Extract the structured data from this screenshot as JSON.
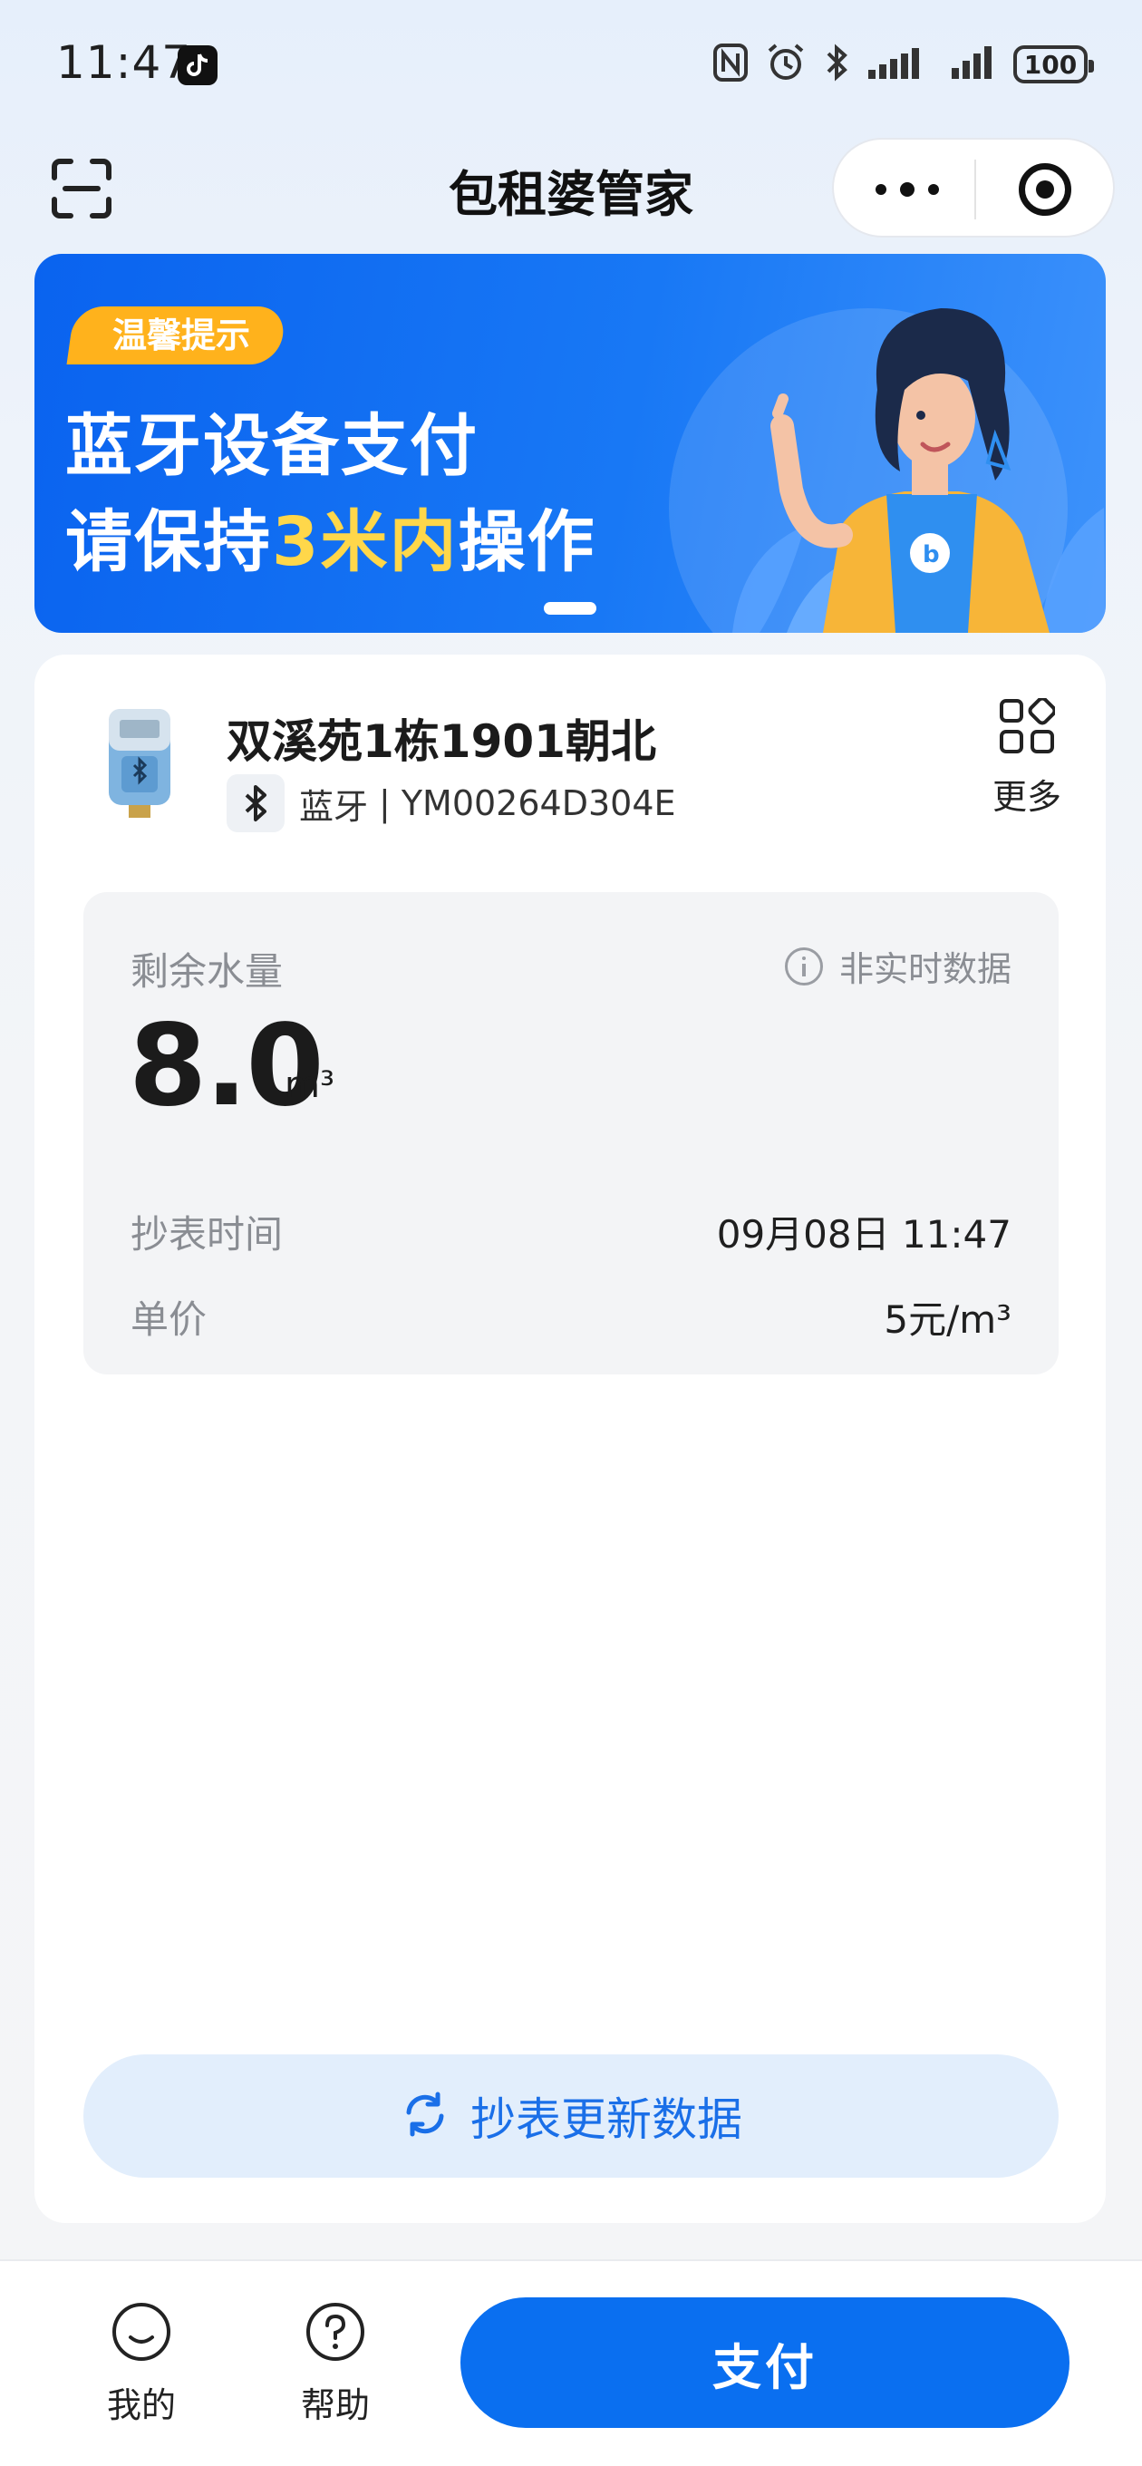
{
  "status_bar": {
    "time": "11:47",
    "battery": "100",
    "icons": [
      "tiktok-icon",
      "nfc-icon",
      "alarm-icon",
      "bluetooth-icon",
      "signal-icon",
      "signal-icon",
      "battery-icon"
    ]
  },
  "navbar": {
    "title": "包租婆管家",
    "icons": [
      "scan-icon",
      "more-dots-icon",
      "close-target-icon"
    ]
  },
  "banner": {
    "tag": "温馨提示",
    "line1": "蓝牙设备支付",
    "line2_prefix": "请保持",
    "line2_highlight": "3米内",
    "line2_suffix": "操作",
    "highlight_color": "#ffd74a"
  },
  "device": {
    "name": "双溪苑1栋1901朝北",
    "connection_type": "蓝牙",
    "separator": "|",
    "device_id": "YM00264D304E",
    "more_label": "更多"
  },
  "reading": {
    "remaining_label": "剩余水量",
    "realtime_note": "非实时数据",
    "remaining_value": "8.0",
    "remaining_unit": "m³",
    "read_time_label": "抄表时间",
    "read_time_value": "09月08日 11:47",
    "unit_price_label": "单价",
    "unit_price_value": "5元/m³"
  },
  "actions": {
    "refresh_label": "抄表更新数据"
  },
  "bottom_bar": {
    "tabs": [
      {
        "label": "我的",
        "icon": "smile-icon"
      },
      {
        "label": "帮助",
        "icon": "help-icon"
      }
    ],
    "pay_label": "支付"
  },
  "colors": {
    "primary": "#0a6ff0",
    "banner_tag": "#ffb21c",
    "refresh_bg": "#e2eefc",
    "refresh_text": "#1a6fe8"
  }
}
